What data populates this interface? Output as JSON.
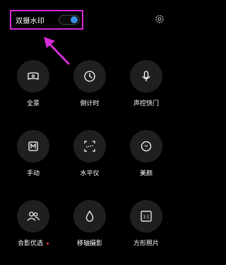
{
  "watermark": {
    "label": "双摄水印",
    "enabled": true,
    "accent_color": "#3b8fe4",
    "highlight_color": "#d42bd8"
  },
  "tiles": [
    {
      "label": "全景",
      "icon": "panorama-icon"
    },
    {
      "label": "倒计时",
      "icon": "timer-icon"
    },
    {
      "label": "声控快门",
      "icon": "microphone-icon"
    },
    {
      "label": "手动",
      "icon": "manual-m-icon"
    },
    {
      "label": "水平仪",
      "icon": "level-icon"
    },
    {
      "label": "美颜",
      "icon": "beauty-icon"
    },
    {
      "label": "合影优选",
      "icon": "group-people-icon",
      "new_badge": true
    },
    {
      "label": "移轴摄影",
      "icon": "tilt-shift-drop-icon"
    },
    {
      "label": "方形照片",
      "icon": "square-photo-icon",
      "icon_text": "1:1"
    }
  ],
  "settings_icon": "gear-icon"
}
